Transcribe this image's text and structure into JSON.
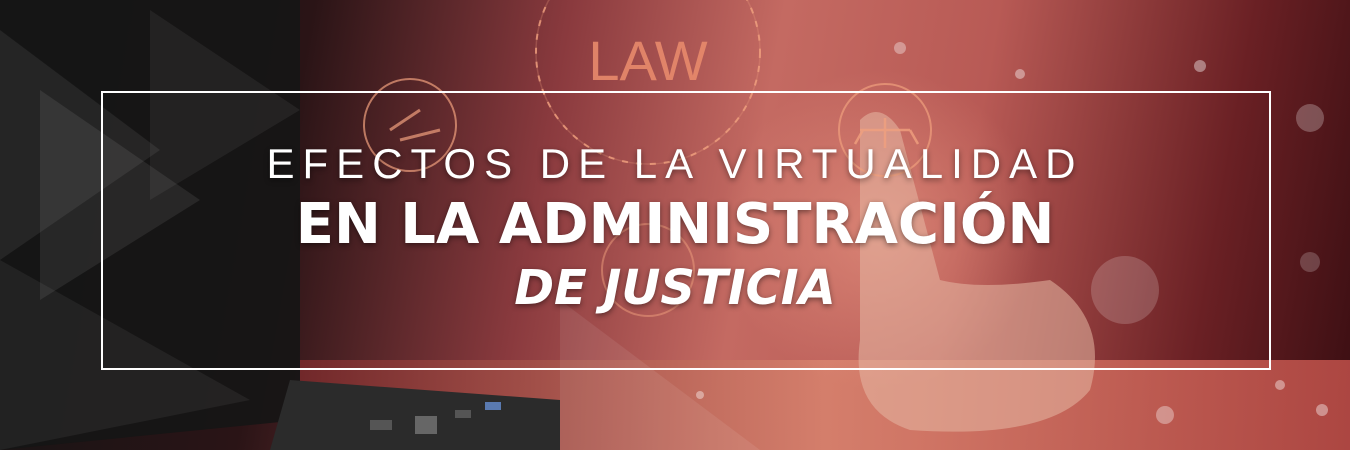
{
  "banner": {
    "emblem_text": "LAW",
    "line1": "EFECTOS DE LA VIRTUALIDAD",
    "line2": "EN LA ADMINISTRACIÓN",
    "line3": "DE JUSTICIA"
  },
  "colors": {
    "accent": "#e07a66",
    "frame": "#ffffff",
    "text": "#ffffff"
  }
}
